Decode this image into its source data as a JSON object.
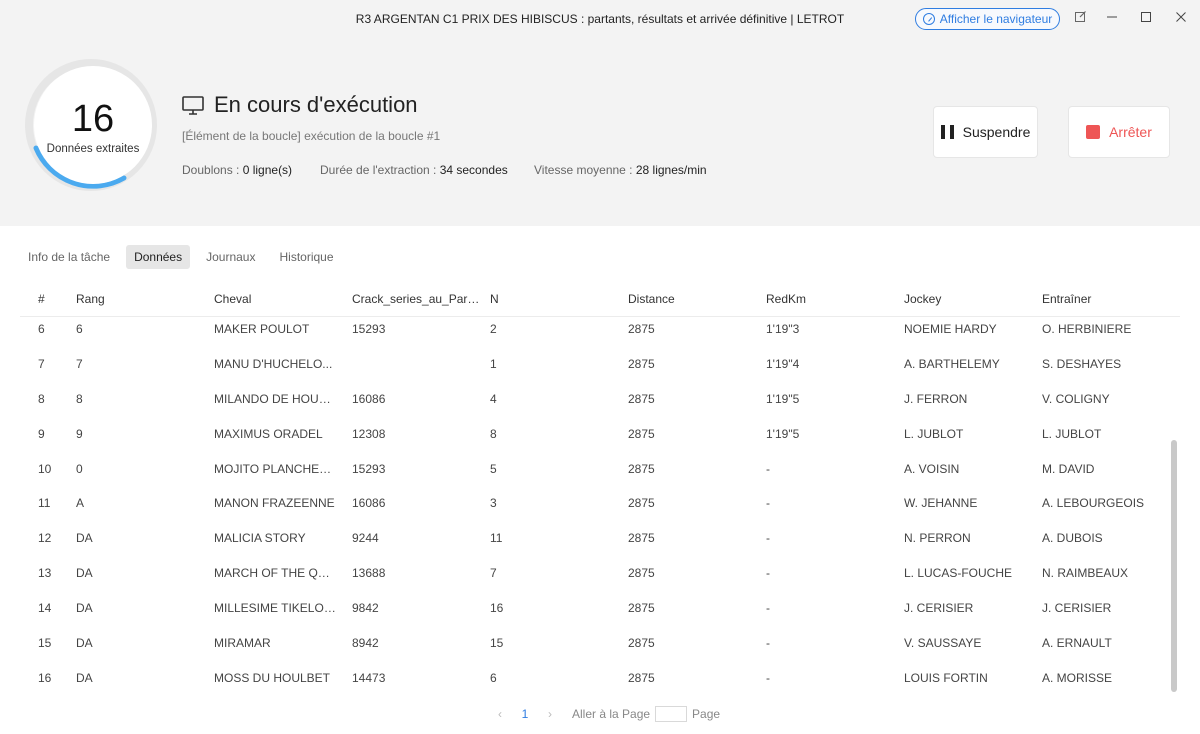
{
  "window": {
    "title": "R3 ARGENTAN C1 PRIX DES HIBISCUS : partants, résultats et arrivée définitive | LETROT",
    "browser_button": "Afficher le navigateur"
  },
  "progress": {
    "count": "16",
    "count_label": "Données extraites",
    "status_title": "En cours d'exécution",
    "subtitle": "[Élément de la boucle] exécution de la boucle #1",
    "doublons_label": "Doublons : ",
    "doublons_value": "0 ligne(s)",
    "duree_label": "Durée de l'extraction : ",
    "duree_value": "34 secondes",
    "vitesse_label": "Vitesse moyenne : ",
    "vitesse_value": "28 lignes/min",
    "suspend_label": "Suspendre",
    "stop_label": "Arrêter"
  },
  "tabs": [
    "Info de la tâche",
    "Données",
    "Journaux",
    "Historique"
  ],
  "table": {
    "headers": [
      "#",
      "Rang",
      "Cheval",
      "Crack_series_au_Par…",
      "N",
      "Distance",
      "RedKm",
      "Jockey",
      "Entraîner"
    ],
    "rows": [
      [
        "6",
        "6",
        "MAKER POULOT",
        "15293",
        "2",
        "2875",
        "1'19\"3",
        "NOEMIE HARDY",
        "O. HERBINIERE"
      ],
      [
        "7",
        "7",
        "MANU D'HUCHELO...",
        "",
        "1",
        "2875",
        "1'19\"4",
        "A. BARTHELEMY",
        "S. DESHAYES"
      ],
      [
        "8",
        "8",
        "MILANDO DE HOUE...",
        "16086",
        "4",
        "2875",
        "1'19\"5",
        "J. FERRON",
        "V. COLIGNY"
      ],
      [
        "9",
        "9",
        "MAXIMUS ORADEL",
        "12308",
        "8",
        "2875",
        "1'19\"5",
        "L. JUBLOT",
        "L. JUBLOT"
      ],
      [
        "10",
        "0",
        "MOJITO PLANCHETTE",
        "15293",
        "5",
        "2875",
        "-",
        "A. VOISIN",
        "M. DAVID"
      ],
      [
        "11",
        "A",
        "MANON FRAZEENNE",
        "16086",
        "3",
        "2875",
        "-",
        "W. JEHANNE",
        "A. LEBOURGEOIS"
      ],
      [
        "12",
        "DA",
        "MALICIA STORY",
        "9244",
        "11",
        "2875",
        "-",
        "N. PERRON",
        "A. DUBOIS"
      ],
      [
        "13",
        "DA",
        "MARCH OF THE QU...",
        "13688",
        "7",
        "2875",
        "-",
        "L. LUCAS-FOUCHE",
        "N. RAIMBEAUX"
      ],
      [
        "14",
        "DA",
        "MILLESIME TIKELOLE",
        "9842",
        "16",
        "2875",
        "-",
        "J. CERISIER",
        "J. CERISIER"
      ],
      [
        "15",
        "DA",
        "MIRAMAR",
        "8942",
        "15",
        "2875",
        "-",
        "V. SAUSSAYE",
        "A. ERNAULT"
      ],
      [
        "16",
        "DA",
        "MOSS DU HOULBET",
        "14473",
        "6",
        "2875",
        "-",
        "LOUIS FORTIN",
        "A. MORISSE"
      ]
    ]
  },
  "pager": {
    "prev": "‹",
    "current": "1",
    "next": "›",
    "goto_label": "Aller à la Page",
    "page_suffix": "Page"
  },
  "colors": {
    "accent": "#2f7de1",
    "stop": "#e55555",
    "gauge": "#3aa3f0"
  }
}
